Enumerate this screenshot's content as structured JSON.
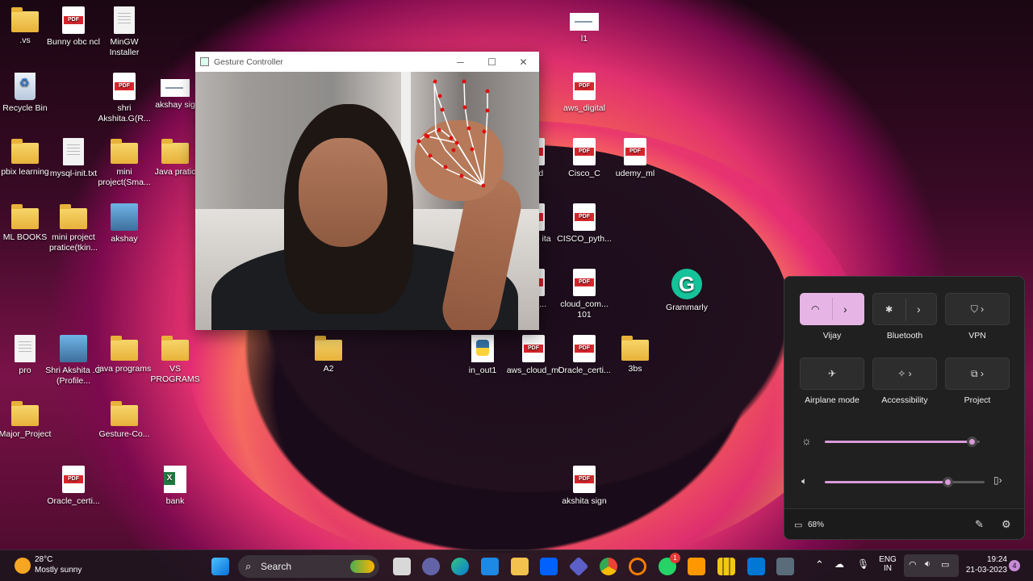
{
  "desktop": {
    "icons": [
      {
        "label": ".vs",
        "kind": "folder"
      },
      {
        "label": "Bunny obc ncl",
        "kind": "pdf"
      },
      {
        "label": "MinGW Installer",
        "kind": "installer"
      },
      {
        "label": "l1",
        "kind": "sig"
      },
      {
        "label": "Recycle Bin",
        "kind": "bin"
      },
      {
        "label": "shri Akshita.G(R...",
        "kind": "pdf"
      },
      {
        "label": "akshay sig",
        "kind": "sig"
      },
      {
        "label": "aws_digital",
        "kind": "pdf"
      },
      {
        "label": "pbix learning",
        "kind": "folder"
      },
      {
        "label": "mysql-init.txt",
        "kind": "doc"
      },
      {
        "label": "mini project(Sma...",
        "kind": "folder"
      },
      {
        "label": "Java pratic",
        "kind": "folder"
      },
      {
        "label": "clg id",
        "kind": "pdf"
      },
      {
        "label": "Cisco_C",
        "kind": "pdf"
      },
      {
        "label": "udemy_ml",
        "kind": "pdf"
      },
      {
        "label": "ML BOOKS",
        "kind": "folder"
      },
      {
        "label": "mini project pratice(tkin...",
        "kind": "folder"
      },
      {
        "label": "akshay",
        "kind": "photo"
      },
      {
        "label": "memo ita",
        "kind": "pdf"
      },
      {
        "label": "CISCO_pyth...",
        "kind": "pdf"
      },
      {
        "label": "oud_...",
        "kind": "pdf"
      },
      {
        "label": "cloud_com... 101",
        "kind": "pdf"
      },
      {
        "label": "Grammarly",
        "kind": "grammarly"
      },
      {
        "label": "pro",
        "kind": "doc"
      },
      {
        "label": "Shri Akshita .G (Profile...",
        "kind": "photo"
      },
      {
        "label": "java programs",
        "kind": "folder"
      },
      {
        "label": "VS PROGRAMS",
        "kind": "folder"
      },
      {
        "label": "A2",
        "kind": "folder"
      },
      {
        "label": "in_out1",
        "kind": "py"
      },
      {
        "label": "aws_cloud_ml",
        "kind": "pdf"
      },
      {
        "label": "Oracle_certi...",
        "kind": "pdf"
      },
      {
        "label": "3bs",
        "kind": "folder"
      },
      {
        "label": "Major_Project",
        "kind": "folder"
      },
      {
        "label": "Gesture-Co...",
        "kind": "folder"
      },
      {
        "label": "Oracle_certi...",
        "kind": "pdf"
      },
      {
        "label": "bank",
        "kind": "xls"
      },
      {
        "label": "akshita sign",
        "kind": "pdf"
      }
    ]
  },
  "window": {
    "title": "Gesture Controller",
    "minimize": "─",
    "maximize": "☐",
    "close": "✕"
  },
  "quick_settings": {
    "wifi_label": "Vijay",
    "bluetooth_label": "Bluetooth",
    "vpn_label": "VPN",
    "airplane_label": "Airplane mode",
    "accessibility_label": "Accessibility",
    "project_label": "Project",
    "brightness": 0.95,
    "volume": 0.77,
    "battery": "68%",
    "accent": "#e6b5e6"
  },
  "taskbar": {
    "weather_temp": "28°C",
    "weather_desc": "Mostly sunny",
    "search_placeholder": "Search",
    "lang_top": "ENG",
    "lang_bottom": "IN",
    "time": "19:24",
    "date": "21-03-2023",
    "notification_count": "4",
    "whatsapp_badge": "1"
  }
}
